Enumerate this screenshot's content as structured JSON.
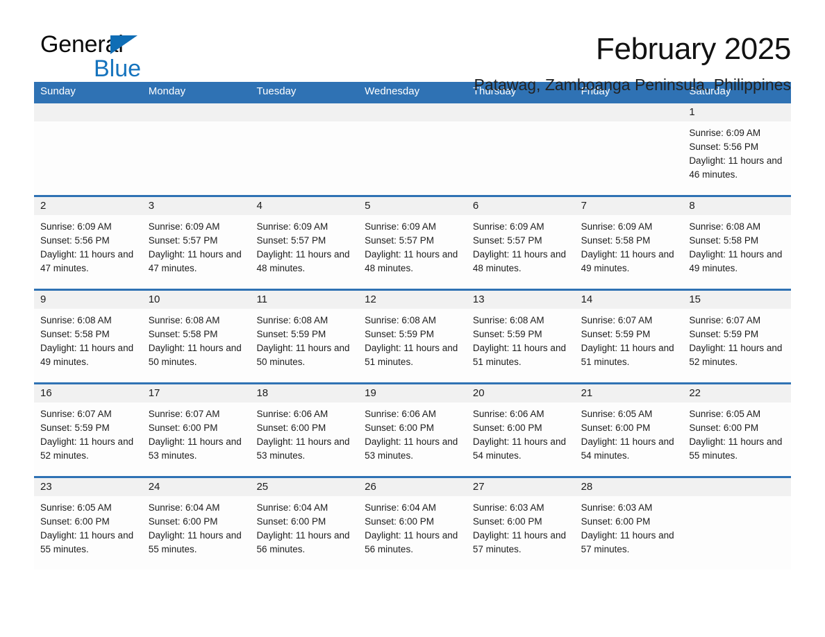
{
  "brand": {
    "name_part1": "General",
    "name_part2": "Blue",
    "triangle_color": "#0f6db5",
    "blue_color": "#1573bd"
  },
  "header": {
    "title": "February 2025",
    "subtitle": "Patawag, Zamboanga Peninsula, Philippines"
  },
  "theme": {
    "header_blue": "#2f72b4",
    "daynum_band": "#f1f1f1",
    "cell_bg": "#fdfdfd",
    "text": "#1c1c1c"
  },
  "weekdays": [
    "Sunday",
    "Monday",
    "Tuesday",
    "Wednesday",
    "Thursday",
    "Friday",
    "Saturday"
  ],
  "weeks": [
    [
      {
        "day": "",
        "sunrise": "",
        "sunset": "",
        "daylight": ""
      },
      {
        "day": "",
        "sunrise": "",
        "sunset": "",
        "daylight": ""
      },
      {
        "day": "",
        "sunrise": "",
        "sunset": "",
        "daylight": ""
      },
      {
        "day": "",
        "sunrise": "",
        "sunset": "",
        "daylight": ""
      },
      {
        "day": "",
        "sunrise": "",
        "sunset": "",
        "daylight": ""
      },
      {
        "day": "",
        "sunrise": "",
        "sunset": "",
        "daylight": ""
      },
      {
        "day": "1",
        "sunrise": "Sunrise: 6:09 AM",
        "sunset": "Sunset: 5:56 PM",
        "daylight": "Daylight: 11 hours and 46 minutes."
      }
    ],
    [
      {
        "day": "2",
        "sunrise": "Sunrise: 6:09 AM",
        "sunset": "Sunset: 5:56 PM",
        "daylight": "Daylight: 11 hours and 47 minutes."
      },
      {
        "day": "3",
        "sunrise": "Sunrise: 6:09 AM",
        "sunset": "Sunset: 5:57 PM",
        "daylight": "Daylight: 11 hours and 47 minutes."
      },
      {
        "day": "4",
        "sunrise": "Sunrise: 6:09 AM",
        "sunset": "Sunset: 5:57 PM",
        "daylight": "Daylight: 11 hours and 48 minutes."
      },
      {
        "day": "5",
        "sunrise": "Sunrise: 6:09 AM",
        "sunset": "Sunset: 5:57 PM",
        "daylight": "Daylight: 11 hours and 48 minutes."
      },
      {
        "day": "6",
        "sunrise": "Sunrise: 6:09 AM",
        "sunset": "Sunset: 5:57 PM",
        "daylight": "Daylight: 11 hours and 48 minutes."
      },
      {
        "day": "7",
        "sunrise": "Sunrise: 6:09 AM",
        "sunset": "Sunset: 5:58 PM",
        "daylight": "Daylight: 11 hours and 49 minutes."
      },
      {
        "day": "8",
        "sunrise": "Sunrise: 6:08 AM",
        "sunset": "Sunset: 5:58 PM",
        "daylight": "Daylight: 11 hours and 49 minutes."
      }
    ],
    [
      {
        "day": "9",
        "sunrise": "Sunrise: 6:08 AM",
        "sunset": "Sunset: 5:58 PM",
        "daylight": "Daylight: 11 hours and 49 minutes."
      },
      {
        "day": "10",
        "sunrise": "Sunrise: 6:08 AM",
        "sunset": "Sunset: 5:58 PM",
        "daylight": "Daylight: 11 hours and 50 minutes."
      },
      {
        "day": "11",
        "sunrise": "Sunrise: 6:08 AM",
        "sunset": "Sunset: 5:59 PM",
        "daylight": "Daylight: 11 hours and 50 minutes."
      },
      {
        "day": "12",
        "sunrise": "Sunrise: 6:08 AM",
        "sunset": "Sunset: 5:59 PM",
        "daylight": "Daylight: 11 hours and 51 minutes."
      },
      {
        "day": "13",
        "sunrise": "Sunrise: 6:08 AM",
        "sunset": "Sunset: 5:59 PM",
        "daylight": "Daylight: 11 hours and 51 minutes."
      },
      {
        "day": "14",
        "sunrise": "Sunrise: 6:07 AM",
        "sunset": "Sunset: 5:59 PM",
        "daylight": "Daylight: 11 hours and 51 minutes."
      },
      {
        "day": "15",
        "sunrise": "Sunrise: 6:07 AM",
        "sunset": "Sunset: 5:59 PM",
        "daylight": "Daylight: 11 hours and 52 minutes."
      }
    ],
    [
      {
        "day": "16",
        "sunrise": "Sunrise: 6:07 AM",
        "sunset": "Sunset: 5:59 PM",
        "daylight": "Daylight: 11 hours and 52 minutes."
      },
      {
        "day": "17",
        "sunrise": "Sunrise: 6:07 AM",
        "sunset": "Sunset: 6:00 PM",
        "daylight": "Daylight: 11 hours and 53 minutes."
      },
      {
        "day": "18",
        "sunrise": "Sunrise: 6:06 AM",
        "sunset": "Sunset: 6:00 PM",
        "daylight": "Daylight: 11 hours and 53 minutes."
      },
      {
        "day": "19",
        "sunrise": "Sunrise: 6:06 AM",
        "sunset": "Sunset: 6:00 PM",
        "daylight": "Daylight: 11 hours and 53 minutes."
      },
      {
        "day": "20",
        "sunrise": "Sunrise: 6:06 AM",
        "sunset": "Sunset: 6:00 PM",
        "daylight": "Daylight: 11 hours and 54 minutes."
      },
      {
        "day": "21",
        "sunrise": "Sunrise: 6:05 AM",
        "sunset": "Sunset: 6:00 PM",
        "daylight": "Daylight: 11 hours and 54 minutes."
      },
      {
        "day": "22",
        "sunrise": "Sunrise: 6:05 AM",
        "sunset": "Sunset: 6:00 PM",
        "daylight": "Daylight: 11 hours and 55 minutes."
      }
    ],
    [
      {
        "day": "23",
        "sunrise": "Sunrise: 6:05 AM",
        "sunset": "Sunset: 6:00 PM",
        "daylight": "Daylight: 11 hours and 55 minutes."
      },
      {
        "day": "24",
        "sunrise": "Sunrise: 6:04 AM",
        "sunset": "Sunset: 6:00 PM",
        "daylight": "Daylight: 11 hours and 55 minutes."
      },
      {
        "day": "25",
        "sunrise": "Sunrise: 6:04 AM",
        "sunset": "Sunset: 6:00 PM",
        "daylight": "Daylight: 11 hours and 56 minutes."
      },
      {
        "day": "26",
        "sunrise": "Sunrise: 6:04 AM",
        "sunset": "Sunset: 6:00 PM",
        "daylight": "Daylight: 11 hours and 56 minutes."
      },
      {
        "day": "27",
        "sunrise": "Sunrise: 6:03 AM",
        "sunset": "Sunset: 6:00 PM",
        "daylight": "Daylight: 11 hours and 57 minutes."
      },
      {
        "day": "28",
        "sunrise": "Sunrise: 6:03 AM",
        "sunset": "Sunset: 6:00 PM",
        "daylight": "Daylight: 11 hours and 57 minutes."
      },
      {
        "day": "",
        "sunrise": "",
        "sunset": "",
        "daylight": ""
      }
    ]
  ]
}
